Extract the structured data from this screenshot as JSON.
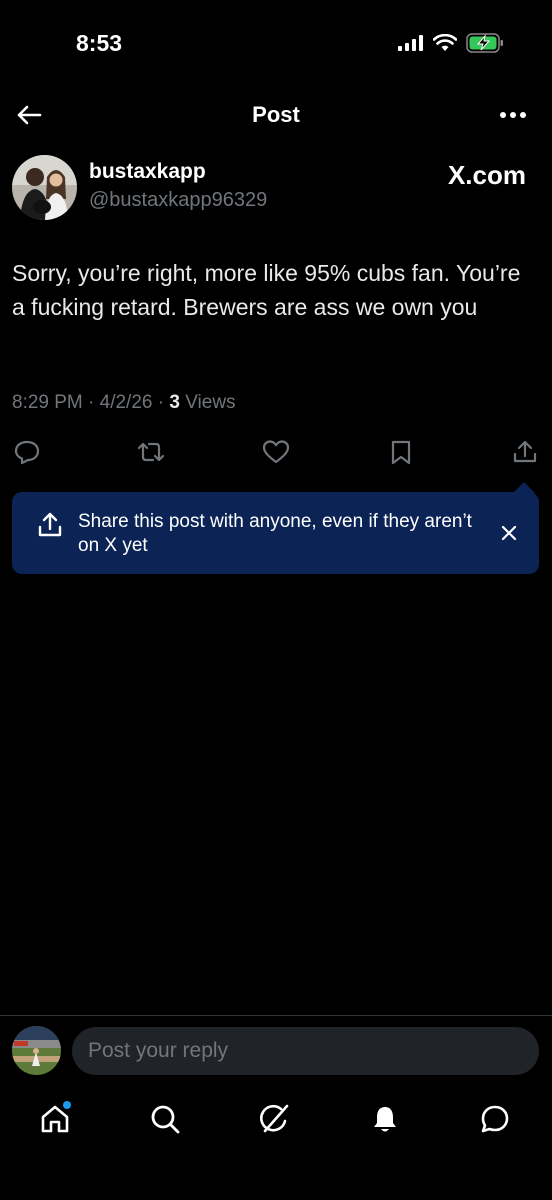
{
  "status_bar": {
    "time": "8:53"
  },
  "header": {
    "title": "Post"
  },
  "author": {
    "display_name": "bustaxkapp",
    "handle": "@bustaxkapp96329"
  },
  "source_label": "X.com",
  "post": {
    "text": "Sorry, you’re right, more like 95% cubs fan. You’re a fucking retard. Brewers are ass we own you",
    "timestamp": "8:29 PM · 4/2/26 · ",
    "views_count": "3",
    "views_label": " Views"
  },
  "actions": [
    "reply-icon",
    "repost-icon",
    "like-icon",
    "bookmark-icon",
    "share-icon"
  ],
  "share_tooltip": {
    "text": "Share this post with anyone, even if they aren’t on X yet"
  },
  "reply": {
    "placeholder": "Post your reply"
  },
  "bottom_nav": [
    "home-icon",
    "search-icon",
    "grok-icon",
    "notifications-icon",
    "messages-icon"
  ],
  "colors": {
    "background": "#000000",
    "tooltip": "#0c2355",
    "accent": "#1d9bf0",
    "muted": "#71767b"
  }
}
